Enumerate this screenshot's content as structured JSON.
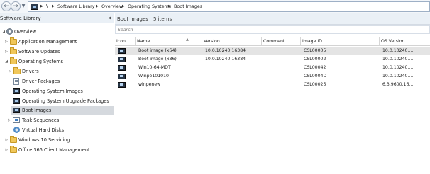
{
  "breadcrumb": {
    "root_separator": "\\",
    "items": [
      "Software Library",
      "Overview",
      "Operating Systems",
      "Boot Images"
    ],
    "separator_glyph": "▶"
  },
  "nav_buttons": {
    "back_icon": "back-arrow-icon",
    "forward_icon": "forward-arrow-icon"
  },
  "nav_pane": {
    "title": "Software Library",
    "collapse_glyph": "◀",
    "items": [
      {
        "label": "Overview",
        "expander": "◢",
        "icon": "gear-icon"
      },
      {
        "label": "Application Management",
        "expander": "▷",
        "icon": "folder-icon"
      },
      {
        "label": "Software Updates",
        "expander": "▷",
        "icon": "folder-icon"
      },
      {
        "label": "Operating Systems",
        "expander": "◢",
        "icon": "folder-icon"
      },
      {
        "label": "Drivers",
        "expander": "▷",
        "icon": "folder-icon"
      },
      {
        "label": "Driver Packages",
        "expander": "",
        "icon": "document-icon"
      },
      {
        "label": "Operating System Images",
        "expander": "",
        "icon": "monitor-icon"
      },
      {
        "label": "Operating System Upgrade Packages",
        "expander": "",
        "icon": "monitor-icon"
      },
      {
        "label": "Boot Images",
        "expander": "",
        "icon": "monitor-icon"
      },
      {
        "label": "Task Sequences",
        "expander": "▷",
        "icon": "task-sequence-icon"
      },
      {
        "label": "Virtual Hard Disks",
        "expander": "",
        "icon": "virtual-disk-icon"
      },
      {
        "label": "Windows 10 Servicing",
        "expander": "▷",
        "icon": "folder-icon"
      },
      {
        "label": "Office 365 Client Management",
        "expander": "▷",
        "icon": "folder-icon"
      }
    ]
  },
  "details": {
    "title": "Boot Images",
    "count": "5 items",
    "search_placeholder": "Search",
    "sort_glyph": "▲",
    "columns": [
      "Icon",
      "Name",
      "Version",
      "Comment",
      "Image ID",
      "OS Version"
    ],
    "rows": [
      {
        "name": "Boot image (x64)",
        "version": "10.0.10240.16384",
        "comment": "",
        "image_id": "CSL00005",
        "os_version": "10.0.10240...."
      },
      {
        "name": "Boot image (x86)",
        "version": "10.0.10240.16384",
        "comment": "",
        "image_id": "CSL00002",
        "os_version": "10.0.10240...."
      },
      {
        "name": "Win10-64-MDT",
        "version": "",
        "comment": "",
        "image_id": "CSL00042",
        "os_version": "10.0.10240...."
      },
      {
        "name": "Winpe101010",
        "version": "",
        "comment": "",
        "image_id": "CSL0004D",
        "os_version": "10.0.10240...."
      },
      {
        "name": "winpenew",
        "version": "",
        "comment": "",
        "image_id": "CSL00025",
        "os_version": "6.3.9600.16..."
      }
    ]
  },
  "colors": {
    "selected_row": "#e4e4e4",
    "selected_nav": "#d5d9de",
    "pane_header": "#eaf0f6",
    "folder": "#f0c75a"
  }
}
